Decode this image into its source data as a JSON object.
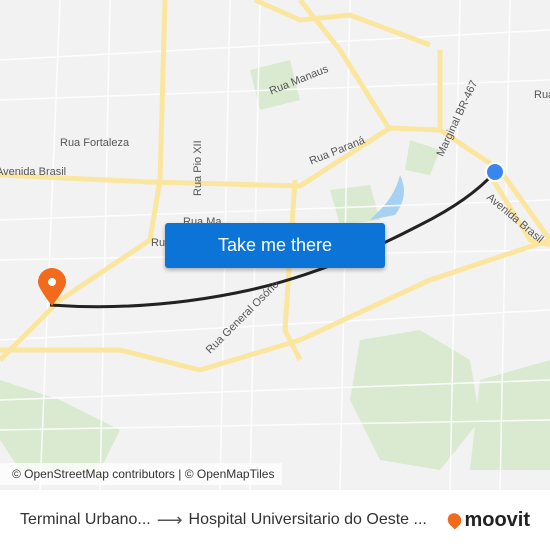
{
  "map": {
    "labels": {
      "rua_manaus": "Rua Manaus",
      "rua_fortaleza": "Rua Fortaleza",
      "avenida_brasil": "Avenida Brasil",
      "rua_pio_xii": "Rua Pio XII",
      "rua_parana": "Rua Paraná",
      "marginal": "Marginal BR-467",
      "avenida_brasil_east": "Avenida Brasil",
      "rua_general_osorio": "Rua General Osório",
      "rua_ma": "Rua Ma",
      "rua_left": "Ru",
      "rua_right": "Rua"
    },
    "route_color": "#222222",
    "origin_color": "#3a86f0",
    "destination_color": "#f26a1b"
  },
  "cta": {
    "label": "Take me there"
  },
  "attribution": "© OpenStreetMap contributors | © OpenMapTiles",
  "footer": {
    "origin": "Terminal Urbano...",
    "arrow": "⟶",
    "destination": "Hospital Universitario do Oeste ...",
    "brand": "moovit"
  }
}
